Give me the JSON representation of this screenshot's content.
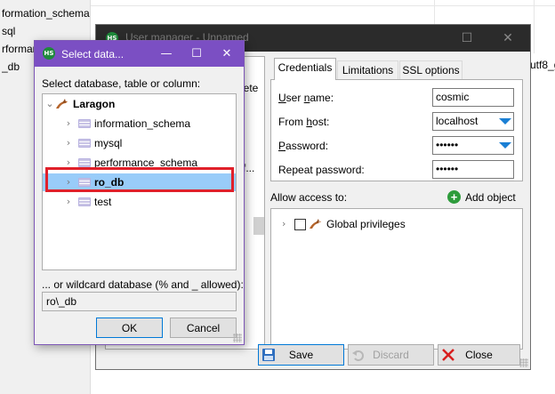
{
  "background": {
    "left_rows": [
      "formation_schema",
      "sql",
      "rformance",
      "_db"
    ],
    "right_fragment": "utf8_g"
  },
  "user_manager": {
    "title": "User manager - Unnamed",
    "left_fragments": [
      "lete",
      "f..."
    ],
    "tabs": [
      "Credentials",
      "Limitations",
      "SSL options"
    ],
    "active_tab": "Credentials",
    "fields": {
      "user_name_label": "User name:",
      "user_name_value": "cosmic",
      "from_host_label": "From host:",
      "from_host_value": "localhost",
      "password_label": "Password:",
      "password_value": "••••••",
      "repeat_password_label": "Repeat password:",
      "repeat_password_value": "••••••"
    },
    "allow_access_label": "Allow access to:",
    "add_object_label": "Add object",
    "privileges_tree": [
      {
        "label": "Global privileges",
        "checked": false
      }
    ],
    "buttons": {
      "save": "Save",
      "discard": "Discard",
      "close": "Close"
    }
  },
  "select_dialog": {
    "title": "Select data...",
    "prompt": "Select database, table or column:",
    "tree": {
      "root": "Laragon",
      "items": [
        "information_schema",
        "mysql",
        "performance_schema",
        "ro_db",
        "test"
      ],
      "selected": "ro_db"
    },
    "wildcard_label": "... or wildcard database (% and _ allowed):",
    "wildcard_value": "ro\\_db",
    "ok_label": "OK",
    "cancel_label": "Cancel"
  },
  "colors": {
    "dialog_titlebar": "#7b4fc3",
    "selection": "#99ccf9",
    "highlight_border": "#e0202a",
    "dropdown_arrow": "#1a7fd4",
    "add_icon": "#2e9c3c"
  }
}
